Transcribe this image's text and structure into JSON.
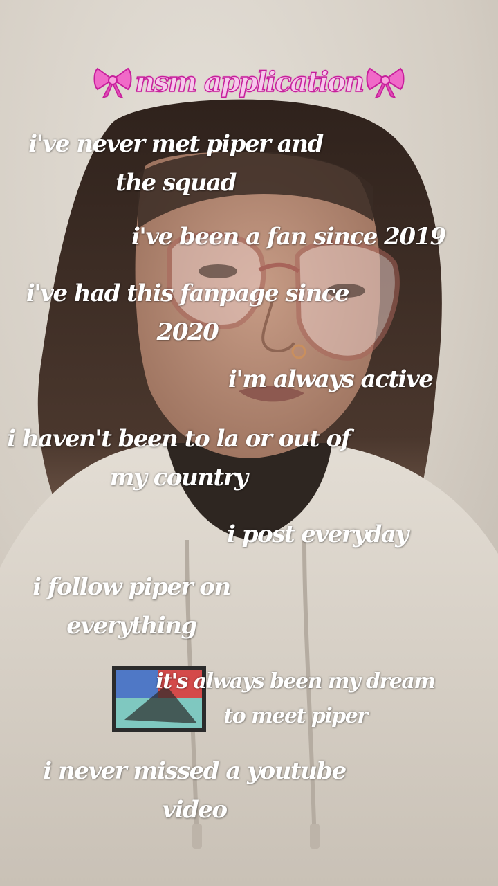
{
  "title": {
    "text": "nsm application",
    "left_icon": "ribbon-bow-icon",
    "right_icon": "ribbon-bow-icon",
    "color": "#f7c8ec",
    "outline_color": "#c71f9c"
  },
  "captions": [
    {
      "lines": [
        "i've never met piper and",
        "the squad"
      ]
    },
    {
      "lines": [
        "i've been a fan since 2019"
      ]
    },
    {
      "lines": [
        "i've had this fanpage since",
        "2020"
      ]
    },
    {
      "lines": [
        "i'm always active"
      ]
    },
    {
      "lines": [
        "i haven't been to la or out of",
        "my country"
      ]
    },
    {
      "lines": [
        "i post everyday"
      ]
    },
    {
      "lines": [
        "i follow piper on",
        "everything"
      ]
    },
    {
      "lines": [
        "it's always been my dream",
        "to meet piper"
      ]
    },
    {
      "lines": [
        "i never missed a youtube",
        "video"
      ]
    }
  ],
  "colors": {
    "wall": "#d9d3c9",
    "hoodie": "#ddd6cd",
    "hair": "#3a2b24",
    "skin": "#b98d78",
    "text": "#ffffff"
  }
}
